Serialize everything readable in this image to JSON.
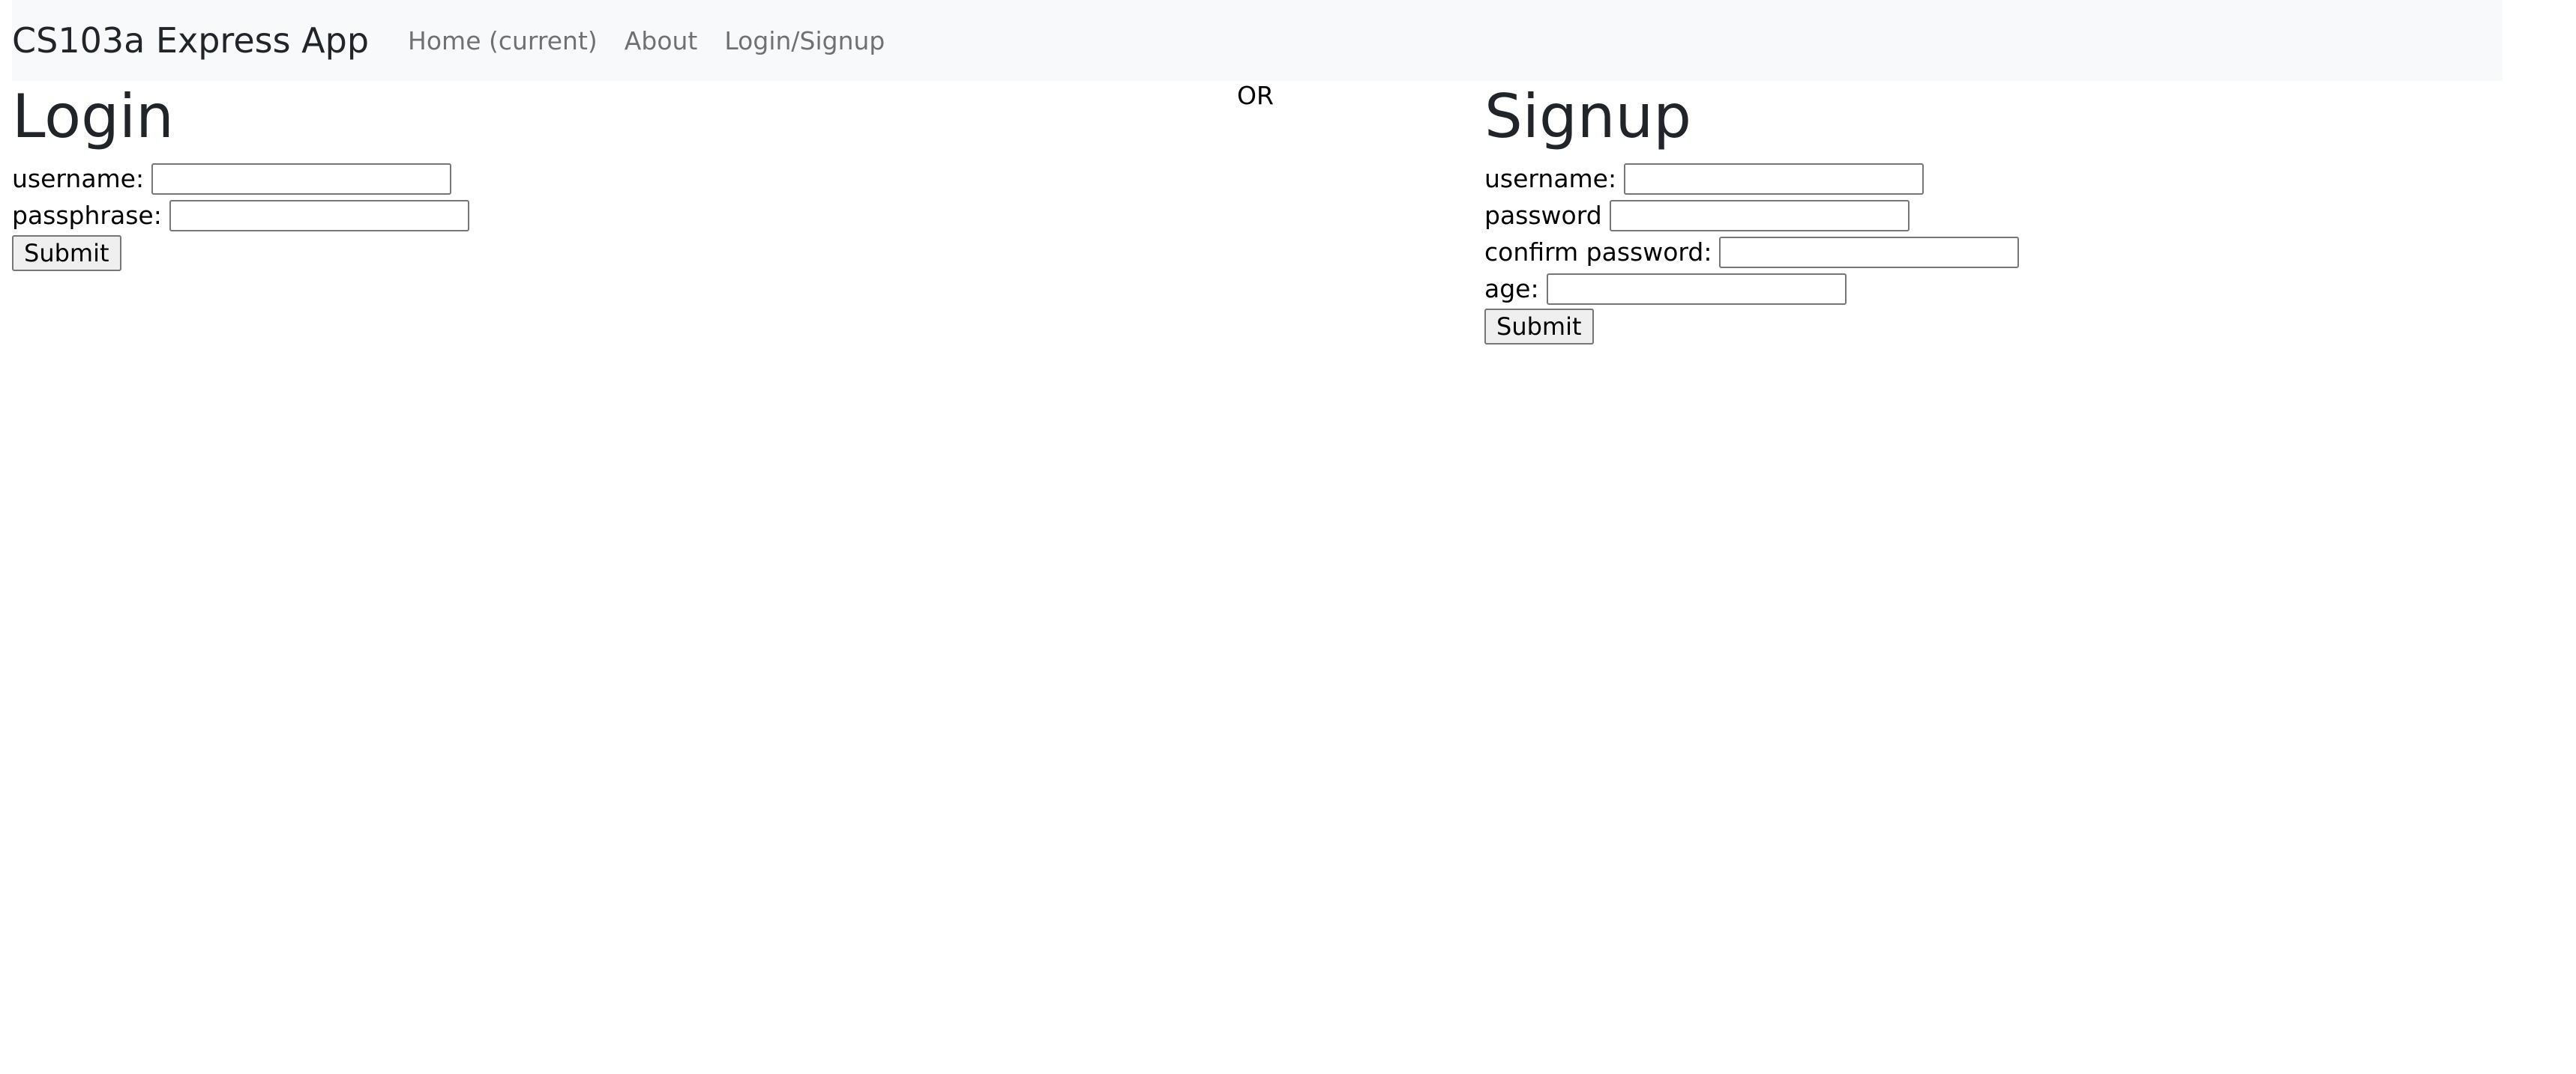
{
  "navbar": {
    "brand": "CS103a Express App",
    "links": [
      {
        "label": "Home (current)"
      },
      {
        "label": "About"
      },
      {
        "label": "Login/Signup"
      }
    ],
    "background": "#f8f9fa"
  },
  "separator": "OR",
  "login": {
    "title": "Login",
    "fields": [
      {
        "label": "username:",
        "value": ""
      },
      {
        "label": "passphrase:",
        "value": ""
      }
    ],
    "submit_label": "Submit"
  },
  "signup": {
    "title": "Signup",
    "fields": [
      {
        "label": "username:",
        "value": ""
      },
      {
        "label": "password",
        "value": ""
      },
      {
        "label": "confirm password:",
        "value": ""
      },
      {
        "label": "age:",
        "value": ""
      }
    ],
    "submit_label": "Submit"
  }
}
